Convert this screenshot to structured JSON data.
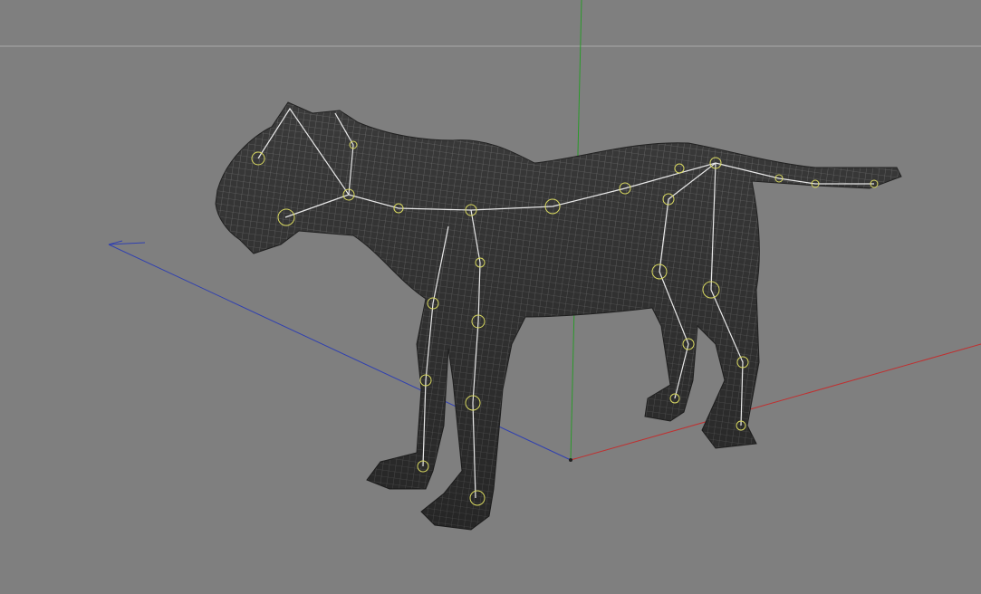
{
  "viewport": {
    "background_color": "#7f7f7f",
    "horizon_color": "#a8a8a8",
    "axes": {
      "x_color": "#c03030",
      "y_color": "#2a9a2a",
      "z_color": "#3040b0"
    },
    "model": {
      "mesh_fill": "#3a3a3a",
      "wire_color": "#9a9a9a",
      "bone_color": "#e8e8e8",
      "joint_color": "#d8d860"
    }
  },
  "icons": [
    "panther-mesh-model",
    "skeleton-rig",
    "world-axes"
  ]
}
